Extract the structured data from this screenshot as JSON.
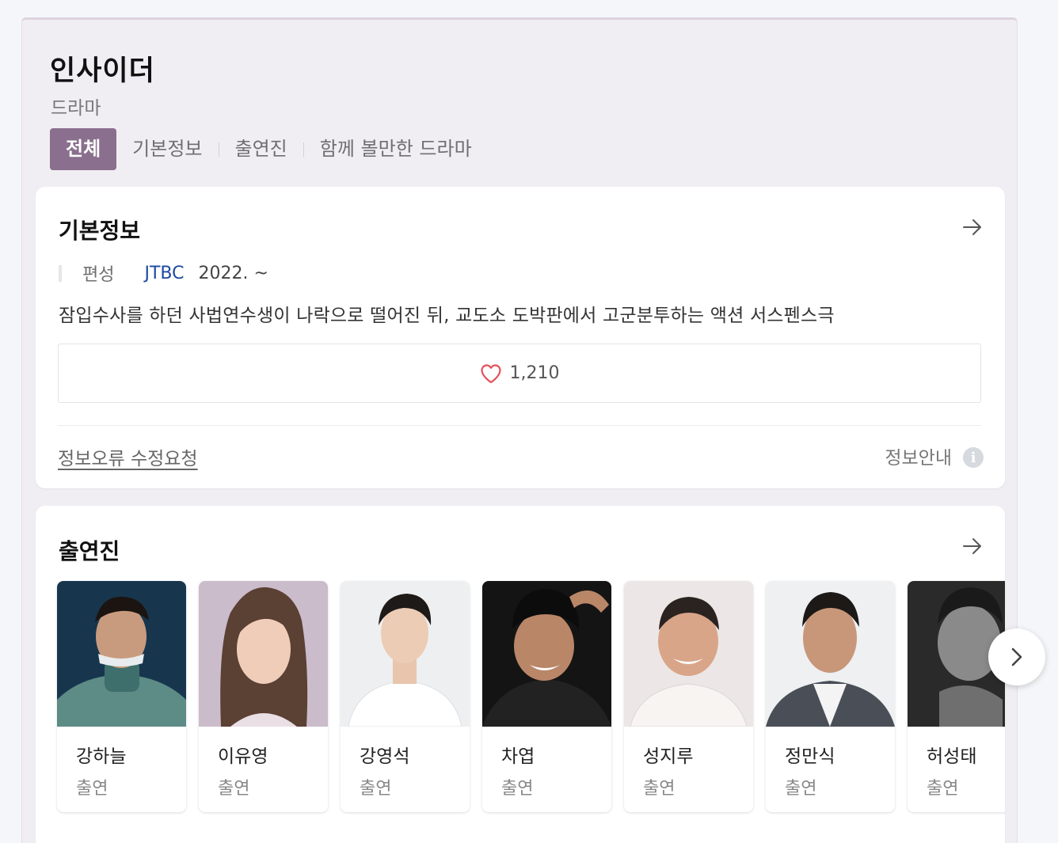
{
  "header": {
    "title": "인사이더",
    "subtitle": "드라마"
  },
  "tabs": [
    {
      "label": "전체",
      "active": true
    },
    {
      "label": "기본정보",
      "active": false
    },
    {
      "label": "출연진",
      "active": false
    },
    {
      "label": "함께 볼만한 드라마",
      "active": false
    }
  ],
  "info": {
    "title": "기본정보",
    "meta_label": "편성",
    "network": "JTBC",
    "date": "2022. ~",
    "description": "잠입수사를 하던 사법연수생이 나락으로 떨어진 뒤, 교도소 도박판에서 고군분투하는 액션 서스펜스극",
    "likes": "1,210",
    "report_link": "정보오류 수정요청",
    "info_guide": "정보안내",
    "info_icon_glyph": "i"
  },
  "cast": {
    "title": "출연진",
    "members": [
      {
        "name": "강하늘",
        "role": "출연"
      },
      {
        "name": "이유영",
        "role": "출연"
      },
      {
        "name": "강영석",
        "role": "출연"
      },
      {
        "name": "차엽",
        "role": "출연"
      },
      {
        "name": "성지루",
        "role": "출연"
      },
      {
        "name": "정만식",
        "role": "출연"
      },
      {
        "name": "허성태",
        "role": "출연"
      }
    ]
  },
  "colors": {
    "accent": "#8a6f8e",
    "network_link": "#1d4aa0",
    "heart": "#e4515a"
  }
}
